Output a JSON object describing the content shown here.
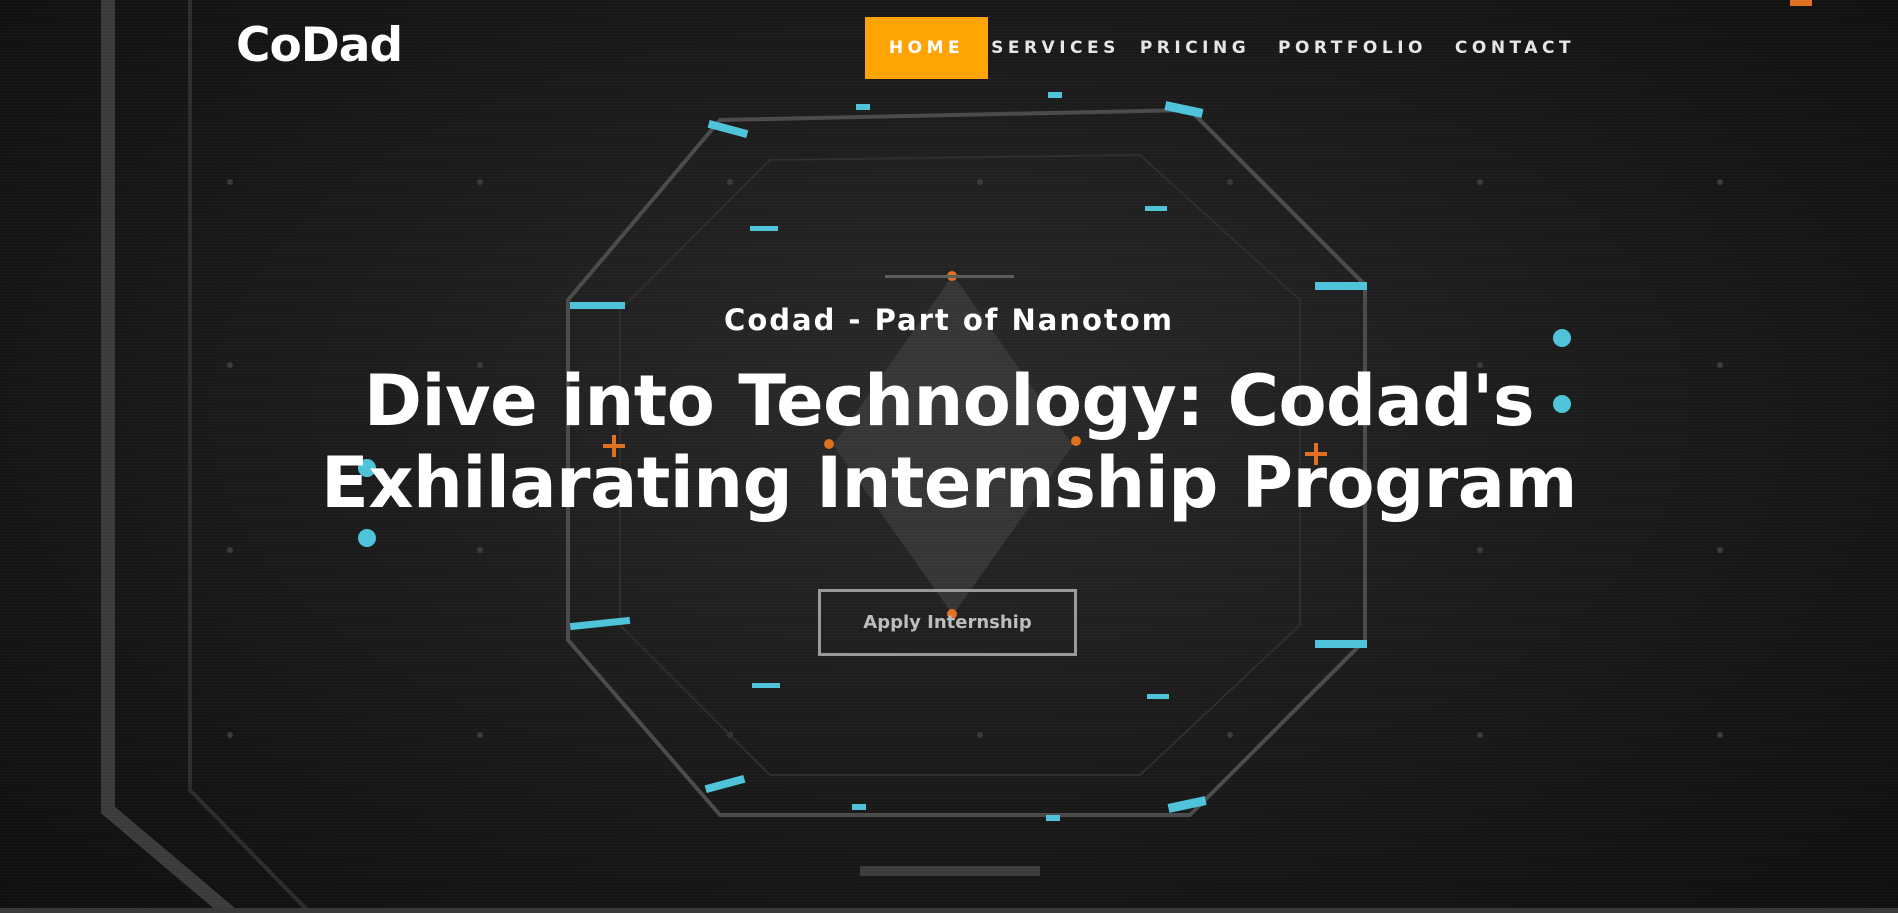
{
  "brand": {
    "logo": "CoDad"
  },
  "nav": {
    "items": [
      {
        "label": "HOME",
        "active": true
      },
      {
        "label": "SERVICES",
        "active": false
      },
      {
        "label": "PRICING",
        "active": false
      },
      {
        "label": "PORTFOLIO",
        "active": false
      },
      {
        "label": "CONTACT",
        "active": false
      }
    ]
  },
  "hero": {
    "subtitle": "Codad - Part of Nanotom",
    "title": "Dive into Technology: Codad's Exhilarating Internship Program",
    "cta_label": "Apply Internship"
  },
  "colors": {
    "accent": "#fea405",
    "background": "#1a1a1a",
    "hud_cyan": "#4ec3d9",
    "hud_orange": "#e0701f"
  },
  "background_image": {
    "icon": "hud-octagon-graphic"
  }
}
